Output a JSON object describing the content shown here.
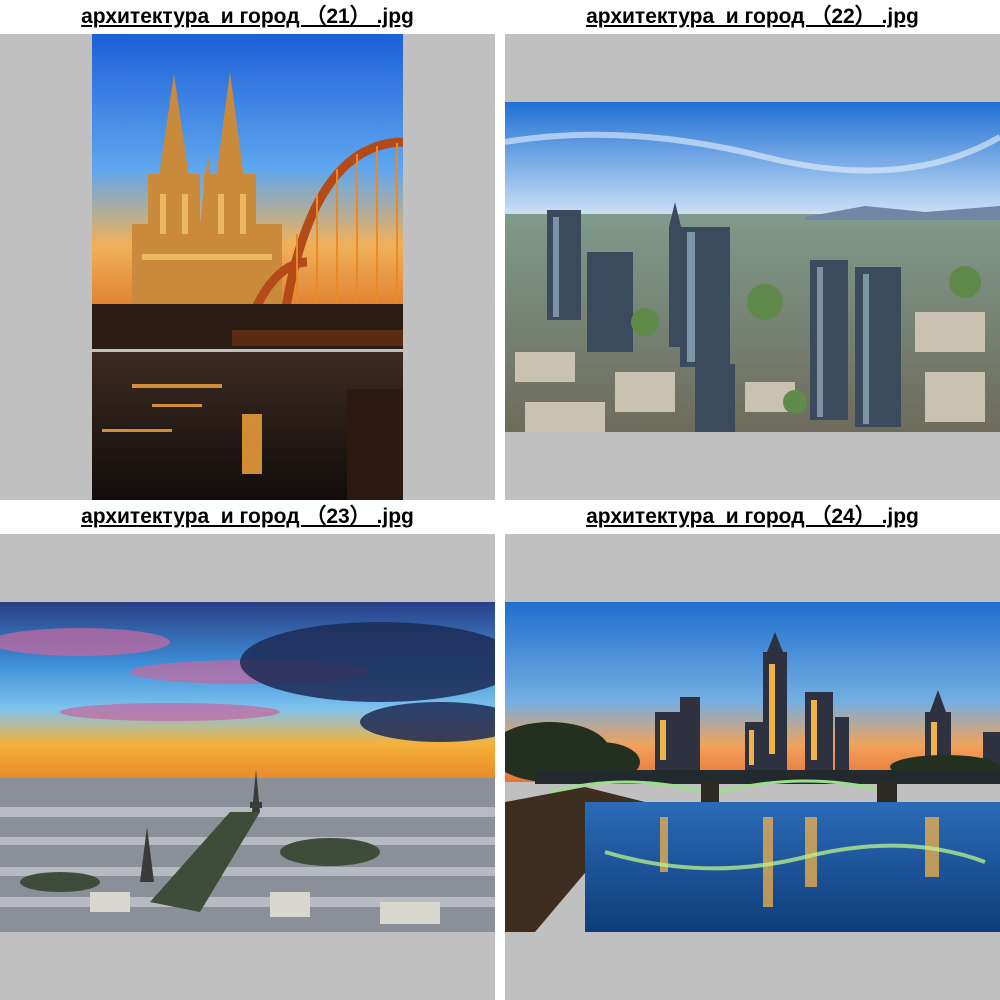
{
  "gallery": {
    "items": [
      {
        "caption": "архитектура  и город （21） .jpg"
      },
      {
        "caption": "архитектура  и город （22） .jpg"
      },
      {
        "caption": "архитектура  и город （23） .jpg"
      },
      {
        "caption": "архитектура  и город （24） .jpg"
      }
    ],
    "colors": {
      "tile_background": "#c0c0c0",
      "caption_text": "#000000"
    }
  }
}
